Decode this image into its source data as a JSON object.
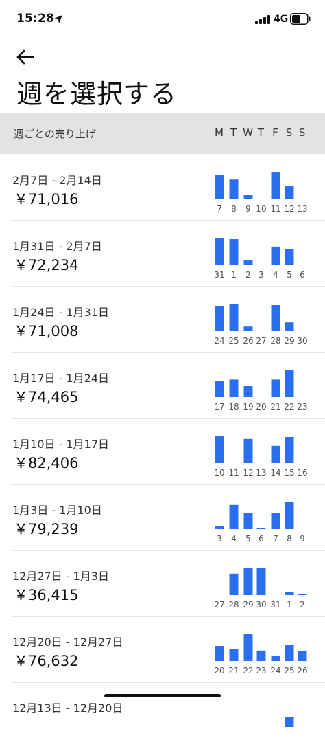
{
  "status_bar": {
    "time": "15:28",
    "network": "4G",
    "icons": [
      "location-arrow-icon",
      "signal-icon",
      "battery-icon"
    ]
  },
  "header": {
    "back_icon": "arrow-left-icon",
    "title": "週を選択する"
  },
  "list_header": {
    "label": "週ごとの売り上げ",
    "days": [
      "M",
      "T",
      "W",
      "T",
      "F",
      "S",
      "S"
    ]
  },
  "colors": {
    "bar": "#2a6ff0",
    "header_bg": "#e3e3e3"
  },
  "chart_data": [
    {
      "type": "bar",
      "range": "2月7日 - 2月14日",
      "total": "￥71,016",
      "categories": [
        "7",
        "8",
        "9",
        "10",
        "11",
        "12",
        "13"
      ],
      "values": [
        0.88,
        0.72,
        0.15,
        0,
        1.0,
        0.5,
        0
      ]
    },
    {
      "type": "bar",
      "range": "1月31日 - 2月7日",
      "total": "￥72,234",
      "categories": [
        "31",
        "1",
        "2",
        "3",
        "4",
        "5",
        "6"
      ],
      "values": [
        1.0,
        0.95,
        0.2,
        0,
        0.68,
        0.58,
        0
      ]
    },
    {
      "type": "bar",
      "range": "1月24日 - 1月31日",
      "total": "￥71,008",
      "categories": [
        "24",
        "25",
        "26",
        "27",
        "28",
        "29",
        "30"
      ],
      "values": [
        0.92,
        1.0,
        0.17,
        0,
        0.95,
        0.32,
        0
      ]
    },
    {
      "type": "bar",
      "range": "1月17日 - 1月24日",
      "total": "￥74,465",
      "categories": [
        "17",
        "18",
        "19",
        "20",
        "21",
        "22",
        "23"
      ],
      "values": [
        0.6,
        0.64,
        0.4,
        0,
        0.64,
        1.0,
        0
      ]
    },
    {
      "type": "bar",
      "range": "1月10日 - 1月17日",
      "total": "￥82,406",
      "categories": [
        "10",
        "11",
        "12",
        "13",
        "14",
        "15",
        "16"
      ],
      "values": [
        1.0,
        0,
        0.88,
        0,
        0.63,
        0.95,
        0
      ]
    },
    {
      "type": "bar",
      "range": "1月3日 - 1月10日",
      "total": "￥79,239",
      "categories": [
        "3",
        "4",
        "5",
        "6",
        "7",
        "8",
        "9"
      ],
      "values": [
        0.1,
        0.88,
        0.6,
        0.03,
        0.58,
        1.0,
        0
      ]
    },
    {
      "type": "bar",
      "range": "12月27日 - 1月3日",
      "total": "￥36,415",
      "categories": [
        "27",
        "28",
        "29",
        "30",
        "31",
        "1",
        "2"
      ],
      "values": [
        0,
        0.78,
        1.0,
        1.0,
        0,
        0.1,
        0.03
      ]
    },
    {
      "type": "bar",
      "range": "12月20日 - 12月27日",
      "total": "￥76,632",
      "categories": [
        "20",
        "21",
        "22",
        "23",
        "24",
        "25",
        "26"
      ],
      "values": [
        0.55,
        0.44,
        1.0,
        0.38,
        0.2,
        0.6,
        0.36
      ]
    },
    {
      "type": "bar",
      "range": "12月13日 - 12月20日",
      "total": "",
      "categories": [],
      "values": [
        0,
        0,
        0,
        0,
        0,
        0.35,
        0
      ]
    }
  ]
}
